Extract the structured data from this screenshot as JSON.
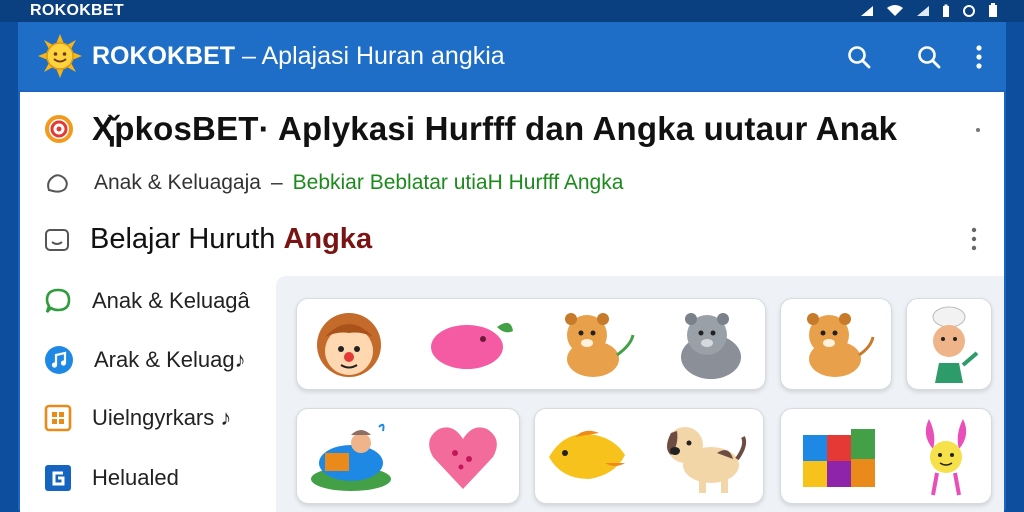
{
  "status_bar": {
    "app_name": "ROKOKBET"
  },
  "app_bar": {
    "brand": "ROKOKBET",
    "subtitle": "– Aplajasi Huran angkia"
  },
  "page": {
    "title": "Ҳ̌pkosBET· Aplykasi Hurfff dan Angka uutaur Anak",
    "breadcrumb": {
      "category": "Anak & Keluagaja",
      "separator": "–",
      "link": "Bebkiar Beblatar utiaH Hurfff Angka"
    },
    "section": {
      "label": "Belajar Huruth ",
      "accent": "Angka"
    }
  },
  "sidebar": {
    "items": [
      {
        "label": "Anak & Keluagâ",
        "icon": "chat-bubble-icon",
        "color": "#2e9c3a"
      },
      {
        "label": "Arak & Keluag♪",
        "icon": "music-note-icon",
        "color": "#1e88e5"
      },
      {
        "label": "Uielngyrkars ♪",
        "icon": "grid-icon",
        "color": "#e98a1b"
      },
      {
        "label": "Helualed",
        "icon": "g-box-icon",
        "color": "#1565c0"
      }
    ]
  },
  "colors": {
    "app_bar": "#1e6ec8",
    "breadcrumb_link": "#1c8a1c",
    "section_accent": "#7a1414"
  }
}
